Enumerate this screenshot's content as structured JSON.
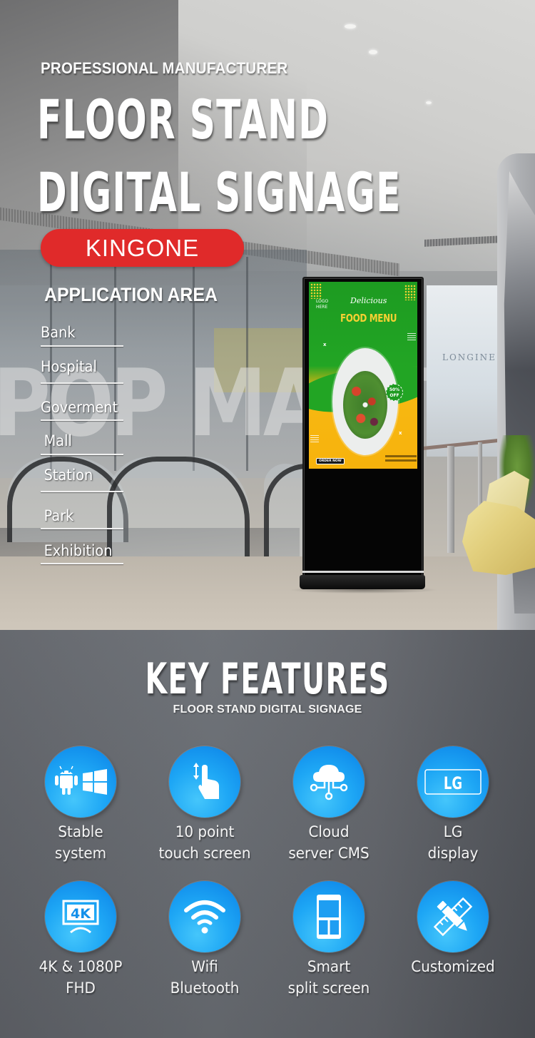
{
  "hero": {
    "kicker": "PROFESSIONAL MANUFACTURER",
    "headline": [
      "FLOOR STAND",
      "DIGITAL SIGNAGE"
    ],
    "brand": "KINGONE",
    "brand_color": "#e02a2a",
    "application_title": "APPLICATION AREA",
    "application_items": [
      "Bank",
      "Hospital",
      "Goverment",
      "Mall",
      "Station",
      "Park",
      "Exhibition"
    ],
    "background_store_sign": "LONGINE",
    "background_mall_sign": "POP MART",
    "kiosk_screen": {
      "logo": [
        "LOGO",
        "HERE"
      ],
      "subtitle": "Delicious",
      "title": "FOOD MENU",
      "badge": [
        "50%",
        "OFF"
      ],
      "order_button": "ORDER NOW",
      "colors": {
        "green": "#22a524",
        "yellow": "#f7b912"
      }
    }
  },
  "features": {
    "title": "KEY FEATURES",
    "subtitle": "FLOOR STAND DIGITAL SIGNAGE",
    "accent_color": "#1ea7f5",
    "items": [
      {
        "icon": "android-windows-icon",
        "label": [
          "Stable",
          "system"
        ]
      },
      {
        "icon": "touch-gesture-icon",
        "label": [
          "10 point",
          "touch screen"
        ]
      },
      {
        "icon": "cloud-network-icon",
        "label": [
          "Cloud",
          "server CMS"
        ]
      },
      {
        "icon": "lg-logo-icon",
        "icon_text": "LG",
        "label": [
          "LG",
          "display"
        ]
      },
      {
        "icon": "4k-monitor-icon",
        "icon_text": "4K",
        "label": [
          "4K & 1080P",
          "FHD"
        ]
      },
      {
        "icon": "wifi-icon",
        "label": [
          "Wifi",
          "Bluetooth"
        ]
      },
      {
        "icon": "split-screen-icon",
        "label": [
          "Smart",
          "split screen"
        ]
      },
      {
        "icon": "pencil-ruler-icon",
        "label": [
          "Customized"
        ]
      }
    ]
  }
}
